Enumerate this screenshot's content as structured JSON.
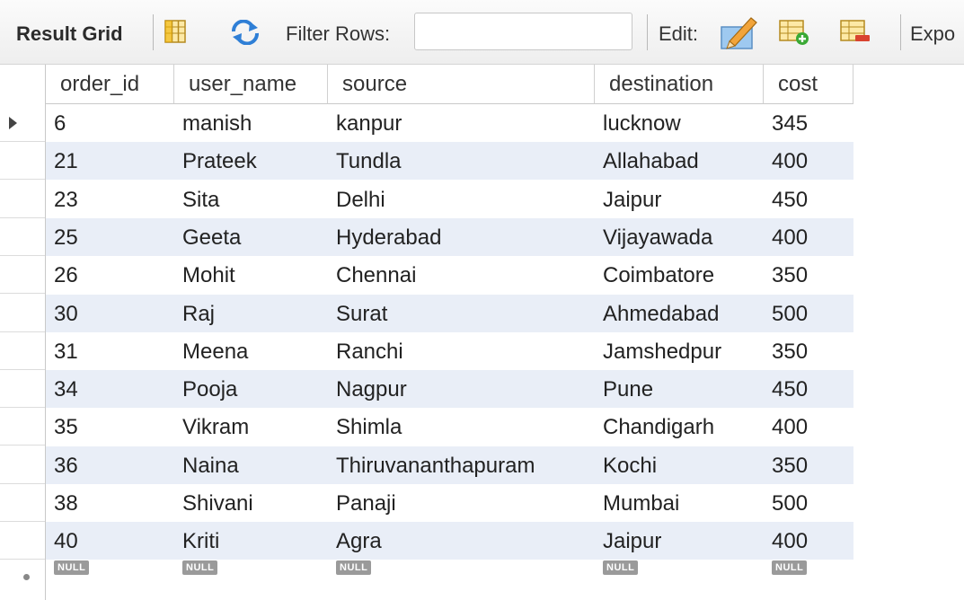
{
  "toolbar": {
    "result_grid_label": "Result Grid",
    "filter_rows_label": "Filter Rows:",
    "filter_value": "",
    "edit_label": "Edit:",
    "export_label": "Expo"
  },
  "columns": [
    "order_id",
    "user_name",
    "source",
    "destination",
    "cost"
  ],
  "rows": [
    [
      "6",
      "manish",
      "kanpur",
      "lucknow",
      "345"
    ],
    [
      "21",
      "Prateek",
      "Tundla",
      "Allahabad",
      "400"
    ],
    [
      "23",
      "Sita",
      "Delhi",
      "Jaipur",
      "450"
    ],
    [
      "25",
      "Geeta",
      "Hyderabad",
      "Vijayawada",
      "400"
    ],
    [
      "26",
      "Mohit",
      "Chennai",
      "Coimbatore",
      "350"
    ],
    [
      "30",
      "Raj",
      "Surat",
      "Ahmedabad",
      "500"
    ],
    [
      "31",
      "Meena",
      "Ranchi",
      "Jamshedpur",
      "350"
    ],
    [
      "34",
      "Pooja",
      "Nagpur",
      "Pune",
      "450"
    ],
    [
      "35",
      "Vikram",
      "Shimla",
      "Chandigarh",
      "400"
    ],
    [
      "36",
      "Naina",
      "Thiruvananthapuram",
      "Kochi",
      "350"
    ],
    [
      "38",
      "Shivani",
      "Panaji",
      "Mumbai",
      "500"
    ],
    [
      "40",
      "Kriti",
      "Agra",
      "Jaipur",
      "400"
    ]
  ],
  "null_label": "NULL",
  "icons": {
    "grid_toggle": "grid-layout-icon",
    "refresh": "refresh-icon",
    "edit": "edit-pencil-icon",
    "add_row": "add-row-icon",
    "delete_row": "delete-row-icon"
  },
  "colors": {
    "alt_row": "#e9eef7",
    "null_badge": "#9a9a9a"
  }
}
